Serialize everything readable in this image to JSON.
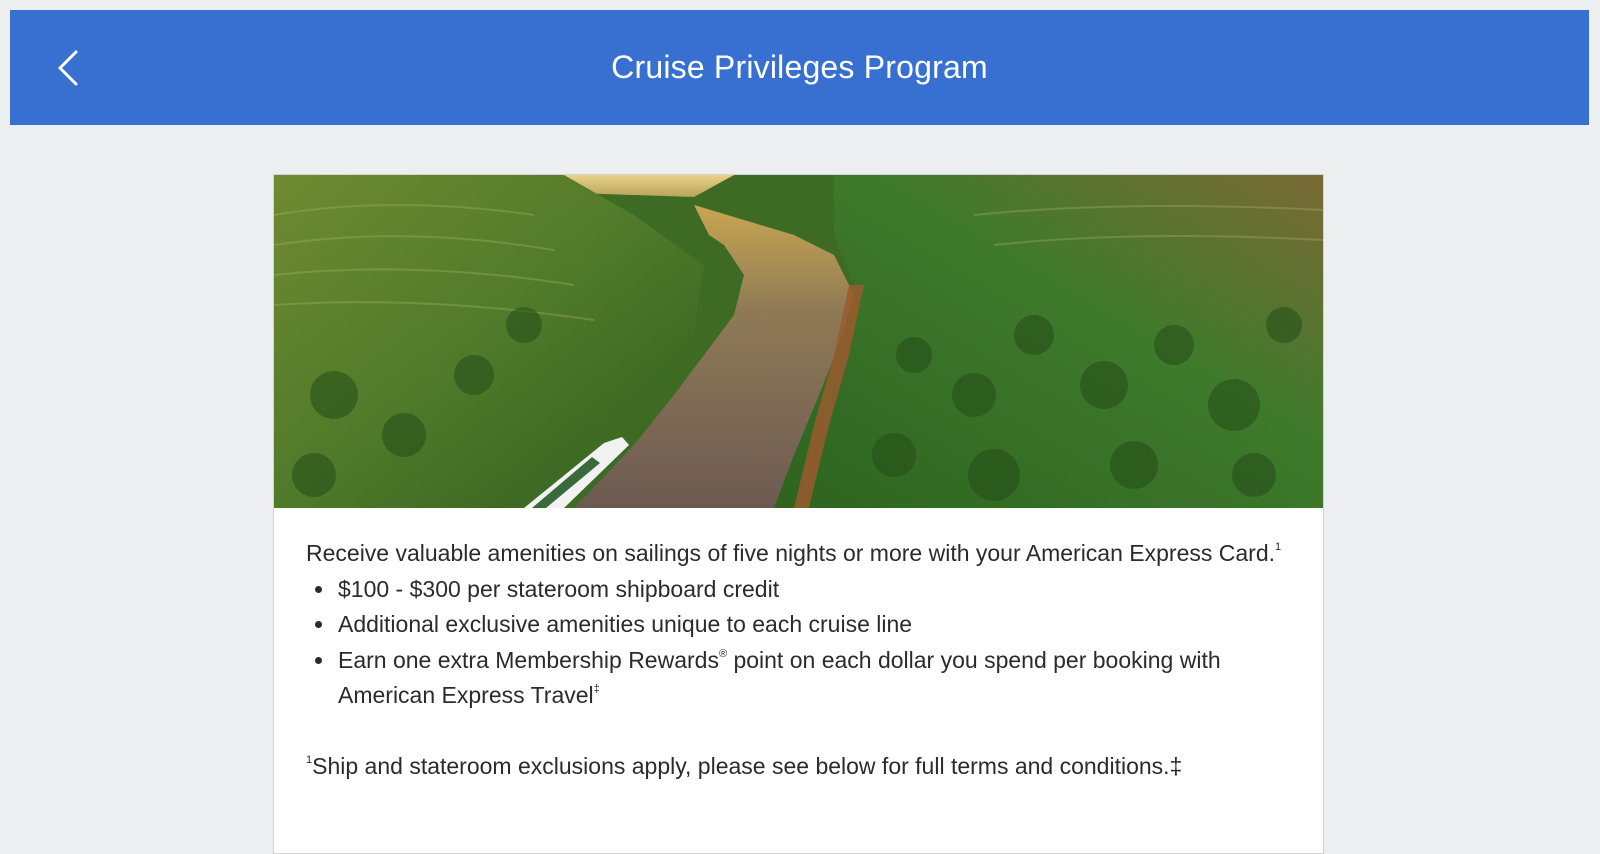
{
  "header": {
    "title": "Cruise Privileges Program",
    "back_icon": "chevron-left-icon",
    "background": "#3870d2"
  },
  "card": {
    "intro_text": "Receive valuable amenities on sailings of five nights or more with your American Express Card.",
    "intro_sup": "1",
    "benefits": [
      {
        "text": "$100 - $300 per stateroom shipboard credit"
      },
      {
        "text": "Additional exclusive amenities unique to each cruise line"
      },
      {
        "text_before": "Earn one extra Membership Rewards",
        "sup": "®",
        "text_after": " point on each dollar you spend per booking with American Express Travel",
        "sup_end": "‡"
      }
    ],
    "footnote_sup": "1",
    "footnote_text": "Ship and stateroom exclusions apply, please see below for full terms and conditions.‡"
  }
}
